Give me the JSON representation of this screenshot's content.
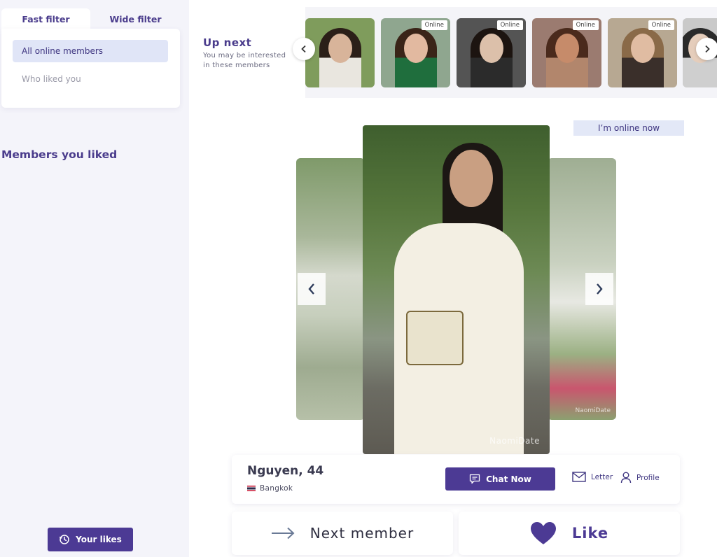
{
  "sidebar": {
    "tabs": [
      {
        "label": "Fast filter",
        "active": true
      },
      {
        "label": "Wide filter",
        "active": false
      }
    ],
    "filter_options": [
      {
        "label": "All online members",
        "selected": true
      },
      {
        "label": "Who liked you",
        "selected": false
      }
    ],
    "liked_title": "Members you liked",
    "your_likes_label": "Your likes"
  },
  "up_next": {
    "title": "Up next",
    "subtitle": "You may be interested in these members",
    "badge_label": "Online",
    "thumbs": [
      {
        "bg": "#7f9c5c",
        "skin": "#d8b49a",
        "hair": "#2b1f18",
        "cloth": "#e9e6df",
        "badge": false
      },
      {
        "bg": "#8fa68f",
        "skin": "#e2b9a0",
        "hair": "#3a2418",
        "cloth": "#1f6e3d",
        "badge": true
      },
      {
        "bg": "#545454",
        "skin": "#dcc0aa",
        "hair": "#1c1410",
        "cloth": "#2b2b2b",
        "badge": true
      },
      {
        "bg": "#9b7b70",
        "skin": "#c68b6a",
        "hair": "#4a2a1c",
        "cloth": "#b2866c",
        "badge": true
      },
      {
        "bg": "#b7a892",
        "skin": "#e0bca2",
        "hair": "#8a6a48",
        "cloth": "#3a2f2a",
        "badge": true
      },
      {
        "bg": "#c9c9c9",
        "skin": "#e5cdbb",
        "hair": "#2a2a2a",
        "cloth": "#cfcfcf",
        "badge": false
      }
    ]
  },
  "online_status": "I’m online now",
  "member": {
    "name": "Nguyen, 44",
    "location": "Bangkok",
    "watermark": "NaomiDate"
  },
  "actions": {
    "chat_label": "Chat Now",
    "letter_label": "Letter",
    "profile_label": "Profile",
    "next_label": "Next member",
    "like_label": "Like"
  },
  "colors": {
    "brand": "#4c3a94",
    "accent_text": "#4a3c8c",
    "selected_bg": "#e0e5f7"
  }
}
